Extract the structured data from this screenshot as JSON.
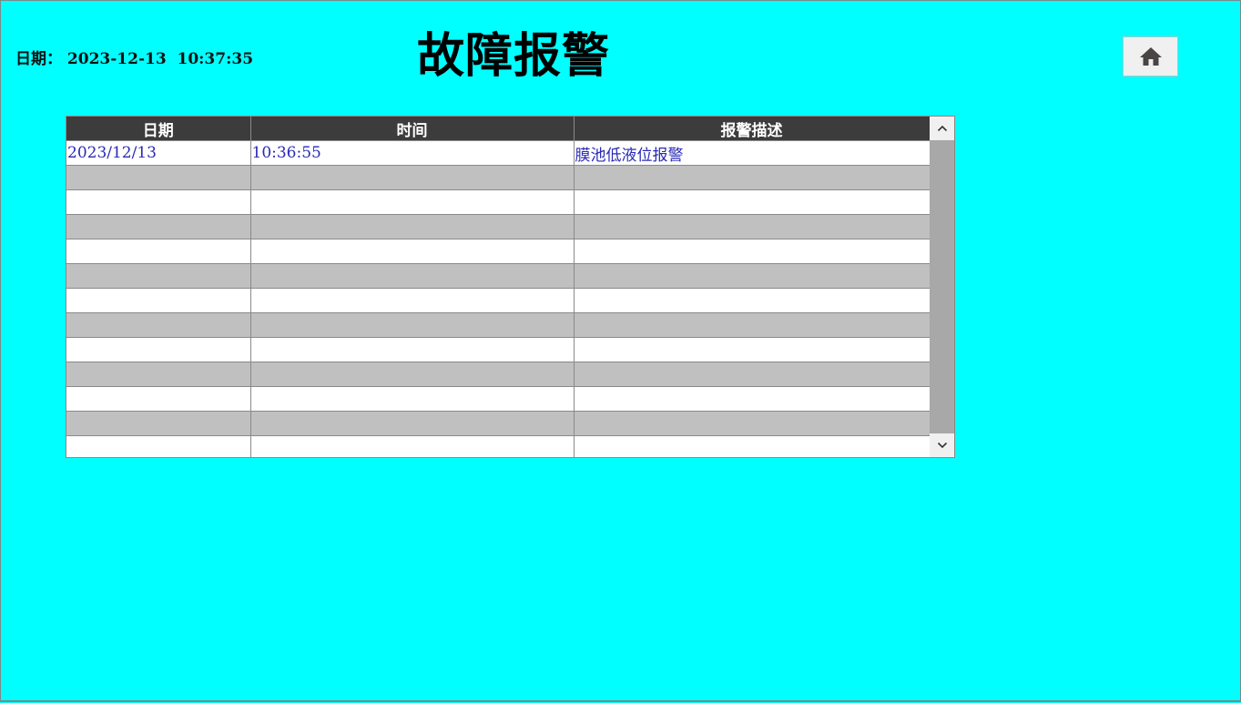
{
  "header": {
    "datetime": "日期： 2023-12-13  10:37:35",
    "title": "故障报警",
    "home_icon": "home-icon"
  },
  "alarm_table": {
    "columns": [
      "日期",
      "时间",
      "报警描述"
    ],
    "rows": [
      [
        "2023/12/13",
        "10:36:55",
        "膜池低液位报警"
      ],
      [
        "",
        "",
        ""
      ],
      [
        "",
        "",
        ""
      ],
      [
        "",
        "",
        ""
      ],
      [
        "",
        "",
        ""
      ],
      [
        "",
        "",
        ""
      ],
      [
        "",
        "",
        ""
      ],
      [
        "",
        "",
        ""
      ],
      [
        "",
        "",
        ""
      ],
      [
        "",
        "",
        ""
      ],
      [
        "",
        "",
        ""
      ],
      [
        "",
        "",
        ""
      ],
      [
        "",
        "",
        ""
      ]
    ],
    "scroll_up_icon": "chevron-up-icon",
    "scroll_down_icon": "chevron-down-icon"
  },
  "colors": {
    "background": "#00ffff",
    "header_bg": "#3c3c3c",
    "row_alt": "#c0c0c0",
    "cell_text": "#2a2ab8"
  }
}
